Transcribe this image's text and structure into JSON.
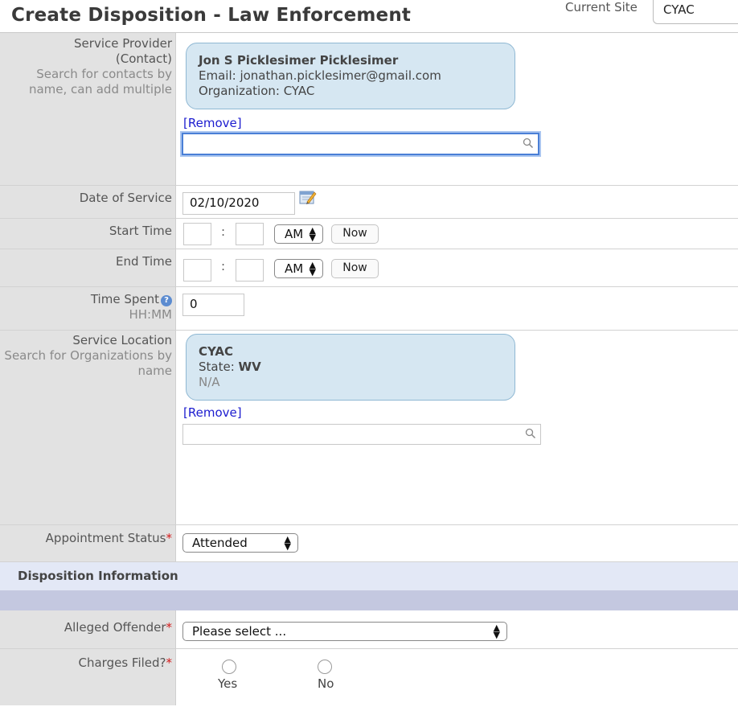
{
  "page": {
    "title": "Create Disposition - Law Enforcement",
    "current_site_label": "Current Site",
    "current_site_value": "CYAC"
  },
  "service_provider": {
    "label": "Service Provider (Contact)",
    "hint": "Search for contacts by name, can add multiple",
    "contact_name": "Jon S Picklesimer Picklesimer",
    "contact_email": "Email: jonathan.picklesimer@gmail.com",
    "contact_org": "Organization: CYAC",
    "remove_label": "[Remove]",
    "search_value": ""
  },
  "date_of_service": {
    "label": "Date of Service",
    "value": "02/10/2020",
    "icon": "calendar-edit-icon"
  },
  "start_time": {
    "label": "Start Time",
    "hour": "",
    "minute": "",
    "separator": ":",
    "ampm": "AM",
    "now_label": "Now"
  },
  "end_time": {
    "label": "End Time",
    "hour": "",
    "minute": "",
    "separator": ":",
    "ampm": "AM",
    "now_label": "Now"
  },
  "time_spent": {
    "label": "Time Spent",
    "hint": "HH:MM",
    "value": "0",
    "icon": "help-icon"
  },
  "service_location": {
    "label": "Service Location",
    "hint": "Search for Organizations by name",
    "org_name": "CYAC",
    "state_label": "State:",
    "state_value": "WV",
    "extra": "N/A",
    "remove_label": "[Remove]",
    "search_value": ""
  },
  "appointment_status": {
    "label": "Appointment Status",
    "required_mark": "*",
    "value": "Attended"
  },
  "disposition_section": {
    "title": "Disposition Information"
  },
  "alleged_offender": {
    "label": "Alleged Offender",
    "required_mark": "*",
    "value": "Please select ..."
  },
  "charges_filed": {
    "label": "Charges Filed?",
    "required_mark": "*",
    "options": [
      "Yes",
      "No"
    ]
  },
  "colors": {
    "label_bg": "#e2e2e2",
    "card_bg": "#d6e7f2",
    "link": "#1c1ccf",
    "required": "#d31a1a",
    "section_bg": "#e3e8f6",
    "section_bar": "#c4c8e0",
    "focus": "#4a7fd6"
  }
}
